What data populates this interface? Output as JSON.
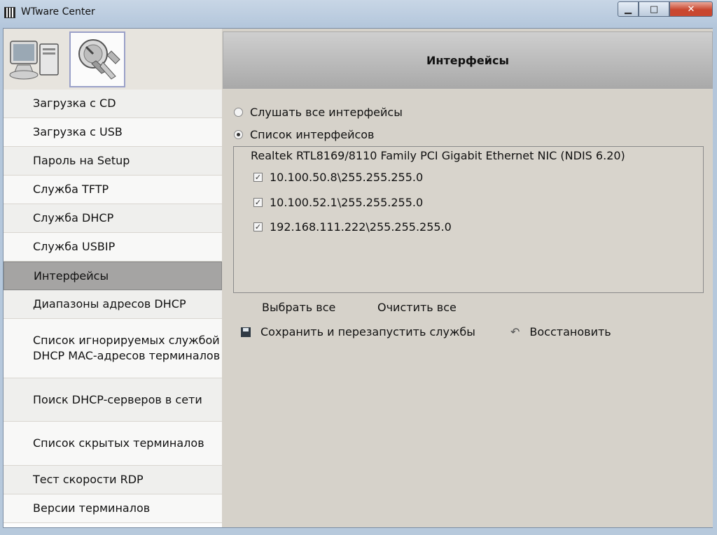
{
  "window": {
    "title": "WTware Center",
    "controls": {
      "minimize": "▁",
      "maximize": "□",
      "close": "✕"
    }
  },
  "toolbar": {
    "icons": [
      "computer-icon",
      "satellite-wrench-icon"
    ]
  },
  "sidebar": {
    "items": [
      {
        "label": "Загрузка с CD"
      },
      {
        "label": "Загрузка с USB"
      },
      {
        "label": "Пароль на Setup"
      },
      {
        "label": "Служба TFTP"
      },
      {
        "label": "Служба DHCP"
      },
      {
        "label": "Служба USBIP"
      },
      {
        "label": "Интерфейсы",
        "active": true
      },
      {
        "label": "Диапазоны адресов DHCP"
      },
      {
        "label": "Список игнорируемых службой DHCP MAC-адресов терминалов"
      },
      {
        "label": "Поиск DHCP-серверов в сети"
      },
      {
        "label": "Список скрытых терминалов"
      },
      {
        "label": "Тест скорости RDP"
      },
      {
        "label": "Версии терминалов"
      }
    ]
  },
  "main": {
    "title": "Интерфейсы",
    "options": [
      {
        "label": "Слушать все интерфейсы",
        "selected": false
      },
      {
        "label": "Список интерфейсов",
        "selected": true
      }
    ],
    "adapter": "Realtek RTL8169/8110 Family PCI Gigabit Ethernet NIC (NDIS 6.20)",
    "addresses": [
      {
        "label": "10.100.50.8\\255.255.255.0",
        "checked": true
      },
      {
        "label": "10.100.52.1\\255.255.255.0",
        "checked": true
      },
      {
        "label": "192.168.111.222\\255.255.255.0",
        "checked": true
      }
    ],
    "select_all": "Выбрать все",
    "clear_all": "Очистить все",
    "save_restart": "Сохранить и перезапустить службы",
    "restore": "Восстановить"
  }
}
